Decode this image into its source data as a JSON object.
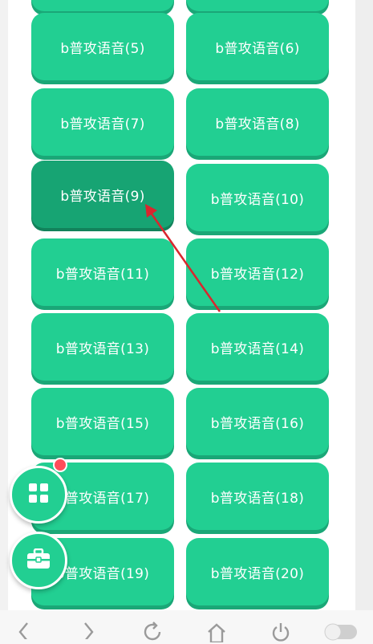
{
  "buttons": [
    {
      "label": ""
    },
    {
      "label": ""
    },
    {
      "label": "b普攻语音(5)"
    },
    {
      "label": "b普攻语音(6)"
    },
    {
      "label": "b普攻语音(7)"
    },
    {
      "label": "b普攻语音(8)"
    },
    {
      "label": "b普攻语音(9)"
    },
    {
      "label": "b普攻语音(10)"
    },
    {
      "label": "b普攻语音(11)"
    },
    {
      "label": "b普攻语音(12)"
    },
    {
      "label": "b普攻语音(13)"
    },
    {
      "label": "b普攻语音(14)"
    },
    {
      "label": "b普攻语音(15)"
    },
    {
      "label": "b普攻语音(16)"
    },
    {
      "label": "b普攻语音(17)"
    },
    {
      "label": "b普攻语音(18)"
    },
    {
      "label": "b普攻语音(19)"
    },
    {
      "label": "b普攻语音(20)"
    }
  ],
  "colors": {
    "button": "#22cf92",
    "button_pressed": "#17a473",
    "annotation_arrow": "#d9262e",
    "badge": "#ff4d5a"
  },
  "icons": {
    "menu_fab": "grid-icon",
    "tools_fab": "toolbox-icon",
    "nav": [
      "back-icon",
      "forward-icon",
      "refresh-icon",
      "home-icon",
      "power-icon",
      "toggle-icon"
    ]
  }
}
